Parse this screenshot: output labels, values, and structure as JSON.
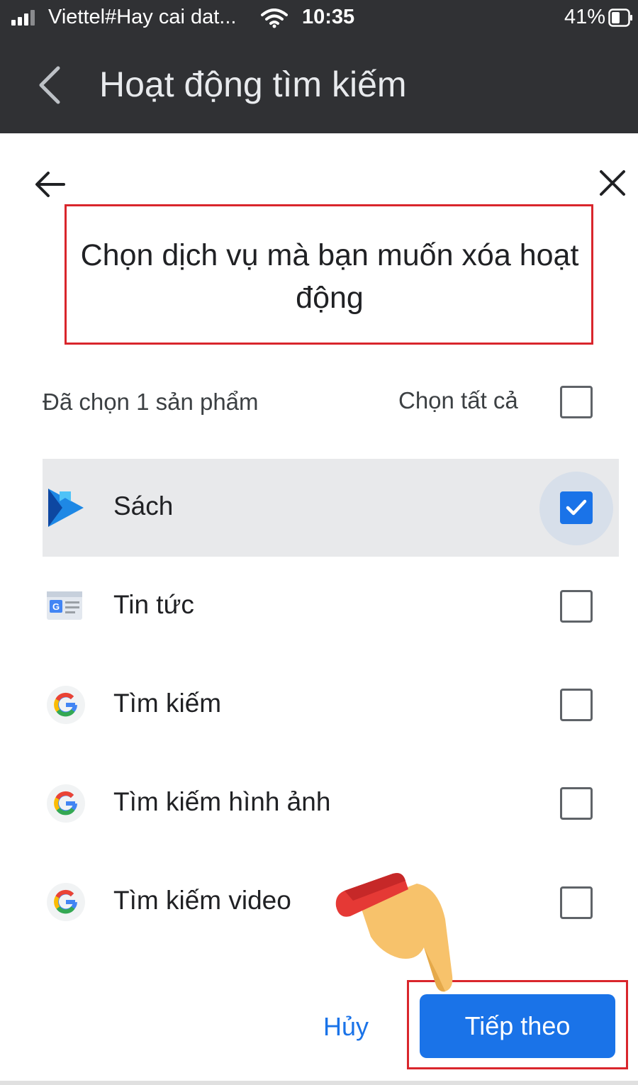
{
  "status_bar": {
    "carrier": "Viettel#Hay cai dat...",
    "time": "10:35",
    "battery": "41%"
  },
  "header": {
    "title": "Hoạt động tìm kiếm"
  },
  "dialog": {
    "title": "Chọn dịch vụ mà bạn muốn xóa hoạt động",
    "selected_count": "Đã chọn 1 sản phẩm",
    "select_all_label": "Chọn tất cả",
    "select_all_checked": false,
    "items": [
      {
        "label": "Sách",
        "icon": "google-play-books-icon",
        "checked": true
      },
      {
        "label": "Tin tức",
        "icon": "google-news-icon",
        "checked": false
      },
      {
        "label": "Tìm kiếm",
        "icon": "google-g-icon",
        "checked": false
      },
      {
        "label": "Tìm kiếm hình ảnh",
        "icon": "google-g-icon",
        "checked": false
      },
      {
        "label": "Tìm kiếm video",
        "icon": "google-g-icon",
        "checked": false
      }
    ],
    "cancel_label": "Hủy",
    "next_label": "Tiếp theo"
  },
  "colors": {
    "header_bg": "#303134",
    "accent": "#1a73e8",
    "highlight_border": "#d9262c",
    "selected_row_bg": "#e8e9eb"
  }
}
